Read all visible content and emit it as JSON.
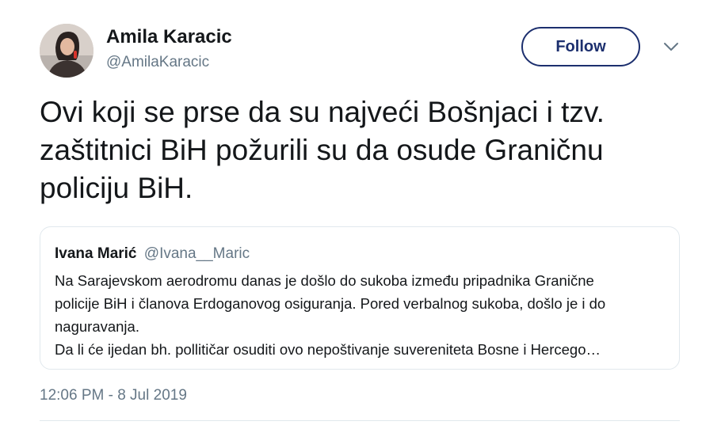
{
  "author": {
    "name": "Amila Karacic",
    "handle": "@AmilaKaracic",
    "avatar_icon": "profile-photo"
  },
  "follow_button": {
    "label": "Follow",
    "color": "#1c2f6e"
  },
  "menu_icon": "chevron-down-icon",
  "tweet": {
    "text": "Ovi koji se prse da su najveći Bošnjaci i tzv.\nzaštitnici BiH požurili su da osude Graničnu\npoliciju BiH."
  },
  "quoted_tweet": {
    "name": "Ivana Marić",
    "handle": "@Ivana__Maric",
    "text": "Na Sarajevskom aerodromu danas je došlo do sukoba između pripadnika Granične\npolicije BiH i članova Erdoganovog osiguranja. Pored verbalnog sukoba, došlo je i do\nnaguravanja.\nDa li će ijedan bh. pollitičar osuditi ovo nepoštivanje suvereniteta Bosne i Hercego…"
  },
  "timestamp": "12:06 PM - 8 Jul 2019",
  "colors": {
    "text_primary": "#14171a",
    "text_secondary": "#657786",
    "border": "#e1e8ed"
  }
}
